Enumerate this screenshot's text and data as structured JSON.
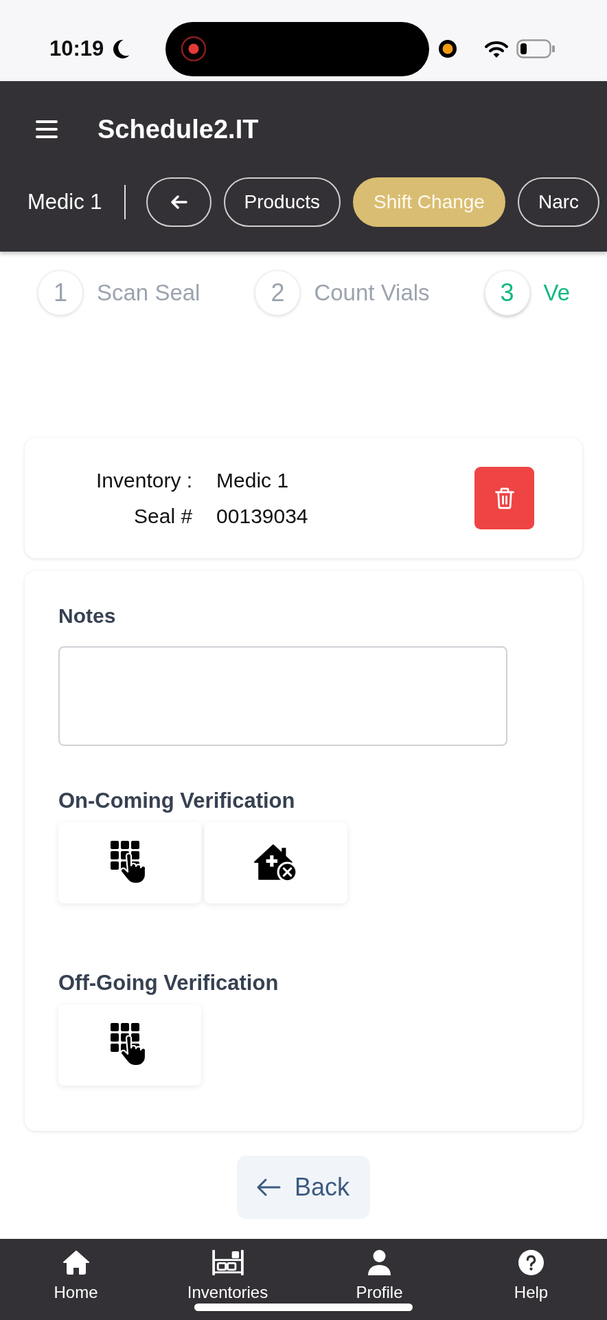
{
  "status_bar": {
    "time": "10:19"
  },
  "header": {
    "title": "Schedule2.IT",
    "inventory": "Medic 1",
    "chips": [
      {
        "kind": "back",
        "selected": false
      },
      {
        "kind": "text",
        "label": "Products",
        "selected": false
      },
      {
        "kind": "text",
        "label": "Shift Change",
        "selected": true
      },
      {
        "kind": "text",
        "label": "Narc",
        "selected": false
      }
    ]
  },
  "stepper": {
    "steps": [
      {
        "number": "1",
        "label": "Scan Seal",
        "selected": false
      },
      {
        "number": "2",
        "label": "Count Vials",
        "selected": false
      },
      {
        "number": "3",
        "label": "Ve",
        "selected": true
      }
    ]
  },
  "seal_card": {
    "fields": [
      {
        "label": "Inventory :",
        "value": "Medic 1"
      },
      {
        "label": "Seal #",
        "value": "00139034"
      }
    ]
  },
  "verification_card": {
    "notes": {
      "label": "Notes"
    },
    "sections": [
      {
        "title": "On-Coming Verification",
        "actions": [
          {
            "kind": "keypad"
          },
          {
            "kind": "remove-house"
          }
        ]
      },
      {
        "title": "Off-Going Verification",
        "actions": [
          {
            "kind": "keypad"
          }
        ]
      }
    ]
  },
  "back_button": {
    "label": "Back"
  },
  "bottom_nav": {
    "items": [
      {
        "kind": "home",
        "label": "Home"
      },
      {
        "kind": "inventories",
        "label": "Inventories"
      },
      {
        "kind": "profile",
        "label": "Profile"
      },
      {
        "kind": "help",
        "label": "Help"
      }
    ]
  }
}
